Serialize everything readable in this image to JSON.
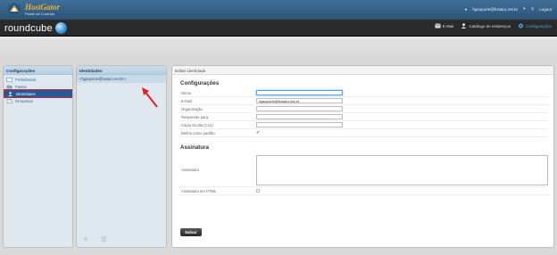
{
  "topbar": {
    "brand": "HostGator",
    "brand_sub": "Painel de Controle",
    "user_email": "hgsuporte@fusiaro.net.br",
    "logout": "Logout"
  },
  "appbar": {
    "app_name": "roundcube",
    "nav": [
      {
        "label": "E-Mail",
        "icon": "envelope-icon",
        "active": false
      },
      {
        "label": "Catálogo de endereços",
        "icon": "contacts-icon",
        "active": false
      },
      {
        "label": "Configurações",
        "icon": "gear-icon",
        "active": true
      }
    ]
  },
  "settings_nav": {
    "header": "Configurações",
    "items": [
      {
        "label": "Preferências",
        "icon": "preferences-icon"
      },
      {
        "label": "Pastas",
        "icon": "folders-icon"
      },
      {
        "label": "Identidades",
        "icon": "identities-icon",
        "selected": true
      },
      {
        "label": "Respostas",
        "icon": "responses-icon"
      }
    ]
  },
  "identities": {
    "header": "Identidades",
    "items": [
      "<hgsuporte@fusiaro.net.br>"
    ]
  },
  "edit": {
    "header": "Editar identidade",
    "section_settings": "Configurações",
    "fields": [
      {
        "label": "Nome",
        "value": ""
      },
      {
        "label": "E-Mail",
        "value": "hgsuporte@fusiaro.net.br"
      },
      {
        "label": "Organização",
        "value": ""
      },
      {
        "label": "Responder para",
        "value": ""
      },
      {
        "label": "Cópia Oculta (Cco)",
        "value": ""
      }
    ],
    "default_label": "Definir como padrão",
    "default_checked": true,
    "section_signature": "Assinatura",
    "signature_label": "Assinatura",
    "signature_value": "",
    "html_signature_label": "Assinatura em HTML",
    "html_signature_checked": false,
    "save_label": "Salvar"
  },
  "colors": {
    "accent": "#1f5b9c",
    "highlight_box": "#e0202a"
  }
}
